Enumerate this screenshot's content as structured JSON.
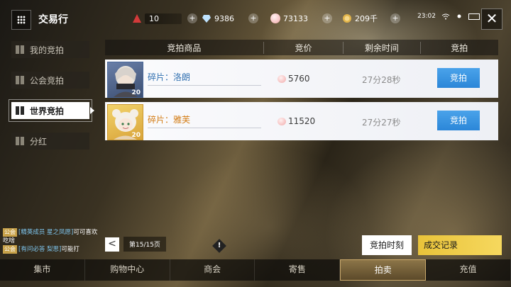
{
  "header": {
    "title": "交易行",
    "clock": "23:02"
  },
  "resources": [
    {
      "icon": "red-triangle-icon",
      "value": "10"
    },
    {
      "icon": "diamond-icon",
      "value": "9386"
    },
    {
      "icon": "peach-icon",
      "value": "73133"
    },
    {
      "icon": "coin-icon",
      "value": "209千"
    }
  ],
  "sidebar": {
    "items": [
      {
        "label": "我的竞拍"
      },
      {
        "label": "公会竞拍"
      },
      {
        "label": "世界竞拍"
      },
      {
        "label": "分红"
      }
    ],
    "active_index": 2
  },
  "table": {
    "headers": [
      "竞拍商品",
      "竞价",
      "剩余时间",
      "竞拍"
    ],
    "rows": [
      {
        "name": "碎片：洛朗",
        "level": "20",
        "price": "5760",
        "time": "27分28秒",
        "button": "竞拍",
        "name_color": "#2f6fb0"
      },
      {
        "name": "碎片：雅芙",
        "level": "20",
        "price": "11520",
        "time": "27分27秒",
        "button": "竞拍",
        "name_color": "#d37c14"
      }
    ]
  },
  "chat": {
    "lines": [
      {
        "tag": "公会",
        "name": "[精英成员 星之凤愿]",
        "text": "可可喜欢吃啥"
      },
      {
        "tag": "公会",
        "name": "[有问必答 梨思]",
        "text": "可能打"
      }
    ]
  },
  "pager": {
    "label": "第15/15页",
    "prev": "<"
  },
  "actions": {
    "auction_time": "竞拍时刻",
    "records": "成交记录"
  },
  "bottom_nav": [
    "集市",
    "购物中心",
    "商会",
    "寄售",
    "拍卖",
    "充值"
  ],
  "bottom_active": 4,
  "colors": {
    "bid_button": "#3596e2",
    "records_button": "#f0cf4a"
  }
}
